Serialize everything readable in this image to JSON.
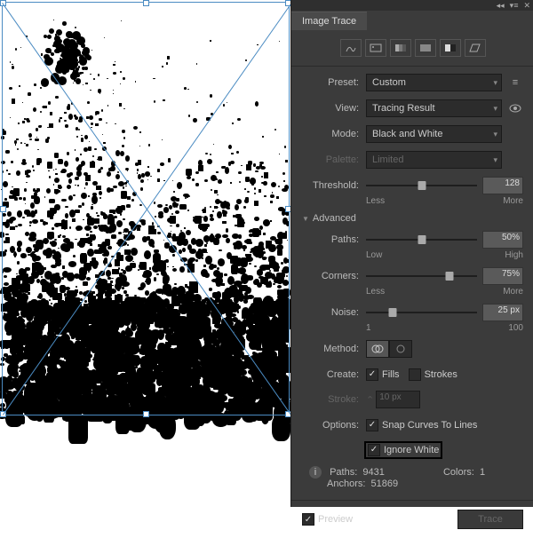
{
  "panel_title": "Image Trace",
  "preset": {
    "label": "Preset:",
    "value": "Custom"
  },
  "view": {
    "label": "View:",
    "value": "Tracing Result"
  },
  "mode": {
    "label": "Mode:",
    "value": "Black and White"
  },
  "palette": {
    "label": "Palette:",
    "value": "Limited"
  },
  "threshold": {
    "label": "Threshold:",
    "value": "128",
    "low": "Less",
    "high": "More"
  },
  "advanced": "Advanced",
  "paths": {
    "label": "Paths:",
    "value": "50%",
    "low": "Low",
    "high": "High"
  },
  "corners": {
    "label": "Corners:",
    "value": "75%",
    "low": "Less",
    "high": "More"
  },
  "noise": {
    "label": "Noise:",
    "value": "25 px",
    "low": "1",
    "high": "100"
  },
  "method": {
    "label": "Method:"
  },
  "create": {
    "label": "Create:",
    "fills": "Fills",
    "strokes": "Strokes"
  },
  "stroke": {
    "label": "Stroke:",
    "value": "10 px"
  },
  "options": {
    "label": "Options:",
    "snap": "Snap Curves To Lines",
    "ignore": "Ignore White"
  },
  "stats": {
    "paths_label": "Paths:",
    "paths": "9431",
    "colors_label": "Colors:",
    "colors": "1",
    "anchors_label": "Anchors:",
    "anchors": "51869"
  },
  "preview": "Preview",
  "trace": "Trace"
}
